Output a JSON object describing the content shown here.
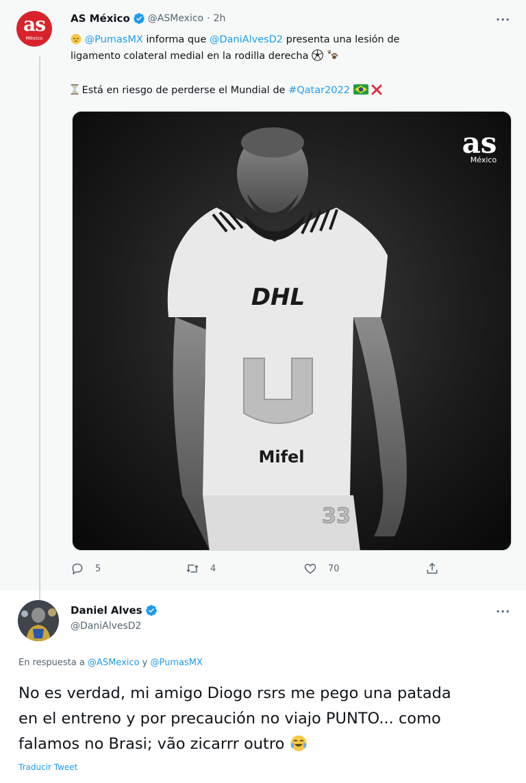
{
  "tweet1": {
    "author_name": "AS México",
    "handle": "@ASMexico",
    "separator": "·",
    "time": "2h",
    "avatar_text": "as",
    "avatar_subtext": "México",
    "line1": {
      "mention1": "@PumasMX",
      "text1": " informa que ",
      "mention2": "@DaniAlvesD2",
      "text2": " presenta una lesión de"
    },
    "line2": "ligamento colateral medial en la rodilla derecha",
    "line3": {
      "text": "Está en riesgo de perderse el Mundial de ",
      "hashtag": "#Qatar2022"
    },
    "media_logo": "as",
    "media_logo_sub": "México",
    "media_shirt_sponsor": "DHL",
    "media_shirt_sponsor2": "Mifel",
    "media_shirt_number": "33",
    "actions": {
      "reply_count": "5",
      "retweet_count": "4",
      "like_count": "70"
    }
  },
  "tweet2": {
    "author_name": "Daniel Alves",
    "handle": "@DaniAlvesD2",
    "reply_prefix": "En respuesta a ",
    "reply_to1": "@ASMexico",
    "reply_join": " y ",
    "reply_to2": "@PumasMX",
    "text_line1": "No es verdad, mi amigo Diogo rsrs me pego una patada",
    "text_line2": "en el entreno y por precaución no viajo PUNTO... como",
    "text_line3": "falamos no Brasi; vão zicarrr outro",
    "translate_label": "Traducir Tweet"
  },
  "colors": {
    "link": "#1d9bf0",
    "as_red": "#d8232a",
    "muted": "#536471",
    "tweet_bg": "#f7f9f9"
  }
}
